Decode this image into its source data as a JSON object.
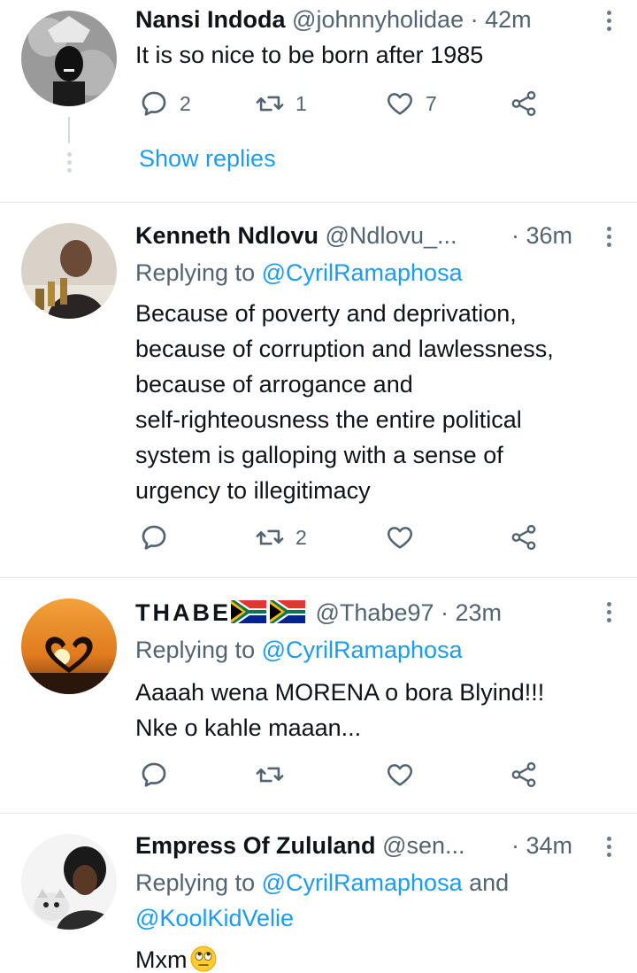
{
  "tweets": [
    {
      "name": "Nansi Indoda",
      "handle": "@johnnyholidae",
      "time": "· 42m",
      "text": "It is so nice to be born after 1985",
      "replies": "2",
      "retweets": "1",
      "likes": "7",
      "show_replies": "Show replies"
    },
    {
      "name": "Kenneth Ndlovu",
      "handle": "@Ndlovu_...",
      "time": "· 36m",
      "replying_prefix": "Replying to",
      "replying_to": "@CyrilRamaphosa",
      "text_lines": [
        "Because of poverty and deprivation,",
        "because of corruption and lawlessness,",
        "because of arrogance and",
        "self-righteousness the entire political",
        "system is galloping with a sense of",
        "urgency to illegitimacy"
      ],
      "retweets": "2"
    },
    {
      "name": "THABE",
      "handle": "@Thabe97",
      "time": "· 23m",
      "replying_prefix": "Replying to",
      "replying_to": "@CyrilRamaphosa",
      "text_lines": [
        "Aaaah wena MORENA o bora Blyind!!!",
        "Nke o kahle maaan..."
      ]
    },
    {
      "name": "Empress Of Zululand",
      "handle": "@sen...",
      "time": "· 34m",
      "replying_prefix": "Replying to",
      "replying_to": "@CyrilRamaphosa",
      "replying_and": "and",
      "replying_to_2": "@KoolKidVelie",
      "text": "Mxm"
    }
  ],
  "icons": {
    "reply": "reply-icon",
    "retweet": "retweet-icon",
    "like": "heart-icon",
    "share": "share-icon",
    "more": "more-vertical-icon"
  },
  "colors": {
    "accent": "#1d9bf0",
    "secondary": "#536471"
  }
}
